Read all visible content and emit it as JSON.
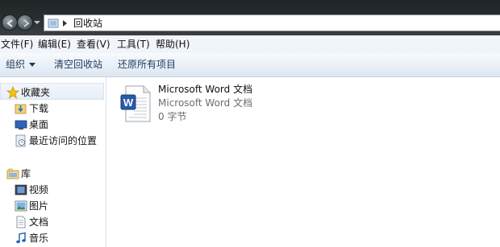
{
  "address_bar": {
    "crumb": "回收站"
  },
  "menu": [
    "文件(F)",
    "编辑(E)",
    "查看(V)",
    "工具(T)",
    "帮助(H)"
  ],
  "commands": {
    "organize": "组织",
    "empty_bin": "清空回收站",
    "restore_all": "还原所有项目"
  },
  "nav": {
    "favorites_header": "收藏夹",
    "favorites": [
      "下载",
      "桌面",
      "最近访问的位置"
    ],
    "libraries_header": "库",
    "libraries": [
      "视频",
      "图片",
      "文档",
      "音乐"
    ]
  },
  "files": [
    {
      "name": "Microsoft Word 文档",
      "type": "Microsoft Word 文档",
      "size": "0 字节"
    }
  ],
  "icons": {
    "back": "arrow-left-icon",
    "forward": "arrow-right-icon",
    "recycle": "recycle-bin-icon",
    "star": "star-icon",
    "download": "download-folder-icon",
    "desktop": "desktop-icon",
    "recent": "recent-places-icon",
    "library": "library-icon",
    "video": "video-icon",
    "pictures": "pictures-icon",
    "documents": "documents-icon",
    "music": "music-icon",
    "word": "word-document-icon"
  },
  "colors": {
    "title_band": "#2a2f31",
    "command_text": "#1e3a5c",
    "secondary_text": "#6d6d6d"
  }
}
